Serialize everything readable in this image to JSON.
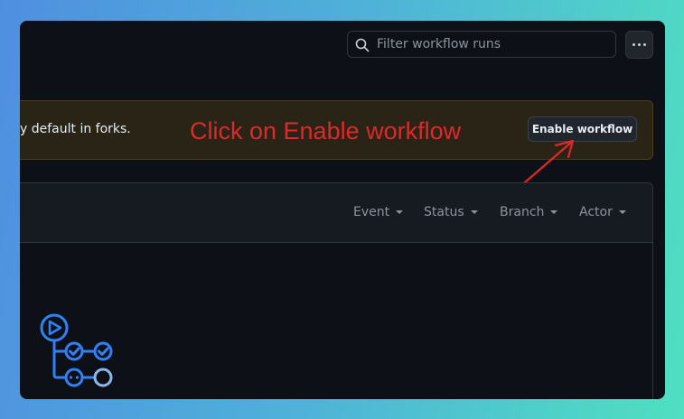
{
  "search": {
    "placeholder": "Filter workflow runs"
  },
  "banner": {
    "text": "y default in forks.",
    "annotation": "Click on Enable workflow",
    "enable_button": "Enable workflow"
  },
  "filters": [
    "Event",
    "Status",
    "Branch",
    "Actor"
  ],
  "colors": {
    "background": "#0d1117",
    "annotation": "#e0282a",
    "accent": "#2f81f7",
    "banner": "#2a2417"
  },
  "icons": {
    "search": "search-icon",
    "more": "kebab-horizontal-icon",
    "workflow": "workflow-illustration"
  }
}
